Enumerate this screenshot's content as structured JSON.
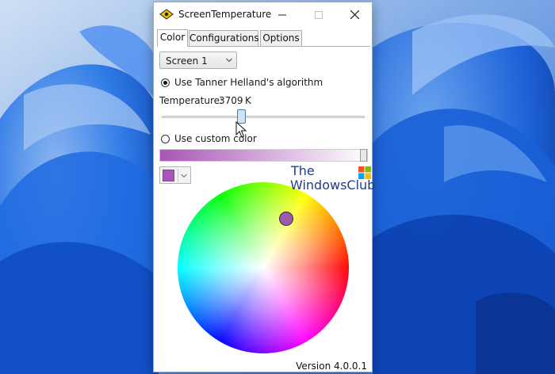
{
  "window": {
    "title": "ScreenTemperature",
    "icon": "eye-icon"
  },
  "tabs": [
    {
      "label": "Color",
      "active": true
    },
    {
      "label": "Configurations",
      "active": false
    },
    {
      "label": "Options",
      "active": false
    }
  ],
  "screen_select": {
    "value": "Screen 1"
  },
  "algorithm": {
    "label": "Use Tanner Helland's algorithm",
    "checked": true,
    "temperature_label": "Temperature:",
    "temperature_value": "3709",
    "temperature_unit": "K",
    "slider_fraction": 0.39
  },
  "custom_color": {
    "label": "Use custom color",
    "checked": false,
    "color": "#a855b5",
    "bar_fraction": 1.0
  },
  "wheel": {
    "marker_color": "#9b5aab",
    "marker_angle_deg": 65,
    "marker_radius_fraction": 0.63
  },
  "version": "Version 4.0.0.1",
  "watermark": {
    "line1": "The",
    "line2": "WindowsClub"
  },
  "colors": {
    "wallpaper_bg": "#3a7ad6",
    "titlebar_bg": "#ffffff",
    "accent": "#3c7fb1"
  }
}
